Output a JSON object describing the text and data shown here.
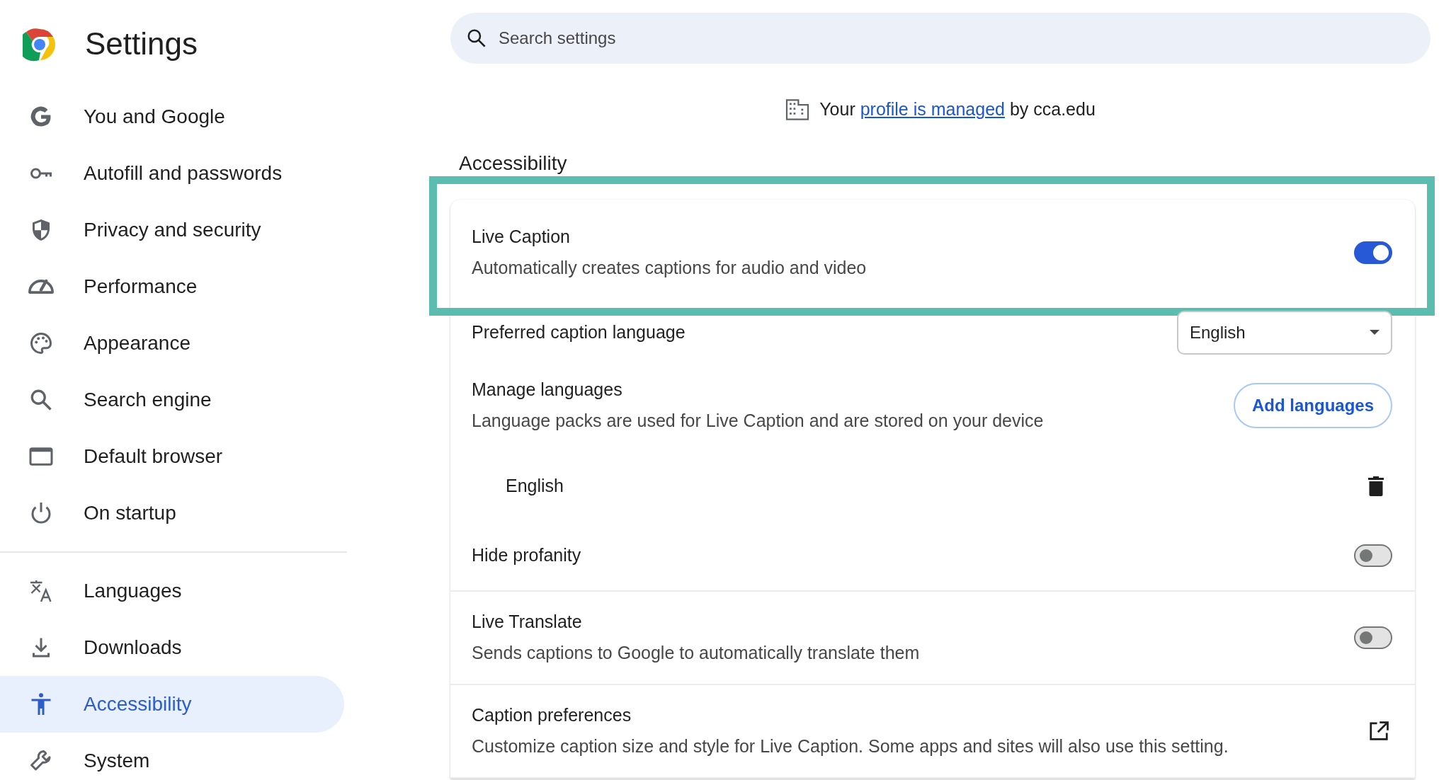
{
  "app": {
    "title": "Settings"
  },
  "search": {
    "placeholder": "Search settings"
  },
  "sidebar": {
    "sections": [
      {
        "items": [
          {
            "label": "You and Google",
            "selected": false
          },
          {
            "label": "Autofill and passwords",
            "selected": false
          },
          {
            "label": "Privacy and security",
            "selected": false
          },
          {
            "label": "Performance",
            "selected": false
          },
          {
            "label": "Appearance",
            "selected": false
          },
          {
            "label": "Search engine",
            "selected": false
          },
          {
            "label": "Default browser",
            "selected": false
          },
          {
            "label": "On startup",
            "selected": false
          }
        ]
      },
      {
        "items": [
          {
            "label": "Languages",
            "selected": false
          },
          {
            "label": "Downloads",
            "selected": false
          },
          {
            "label": "Accessibility",
            "selected": true
          },
          {
            "label": "System",
            "selected": false
          }
        ]
      }
    ]
  },
  "managed_notice": {
    "before": "Your",
    "link": "profile is managed",
    "after": "by cca.edu"
  },
  "section_title": "Accessibility",
  "settings": [
    {
      "kind": "toggle",
      "title": "Live Caption",
      "description": "Automatically creates captions for audio and video",
      "on": true,
      "highlighted": true,
      "children": [
        {
          "kind": "select",
          "title": "Preferred caption language",
          "value": "English",
          "highlighted": false
        },
        {
          "kind": "button",
          "title": "Manage languages",
          "description": "Language packs are used for Live Caption and are stored on your device",
          "button": "Add languages",
          "highlighted": false
        },
        {
          "kind": "language",
          "title": "English",
          "highlighted": false
        },
        {
          "kind": "toggle",
          "title": "Hide profanity",
          "on": false,
          "highlighted": false
        }
      ]
    },
    {
      "kind": "toggle",
      "title": "Live Translate",
      "description": "Sends captions to Google to automatically translate them",
      "on": false,
      "highlighted": false
    },
    {
      "kind": "link",
      "title": "Caption preferences",
      "description": "Customize caption size and style for Live Caption. Some apps and sites will also use this setting.",
      "highlighted": false
    }
  ]
}
